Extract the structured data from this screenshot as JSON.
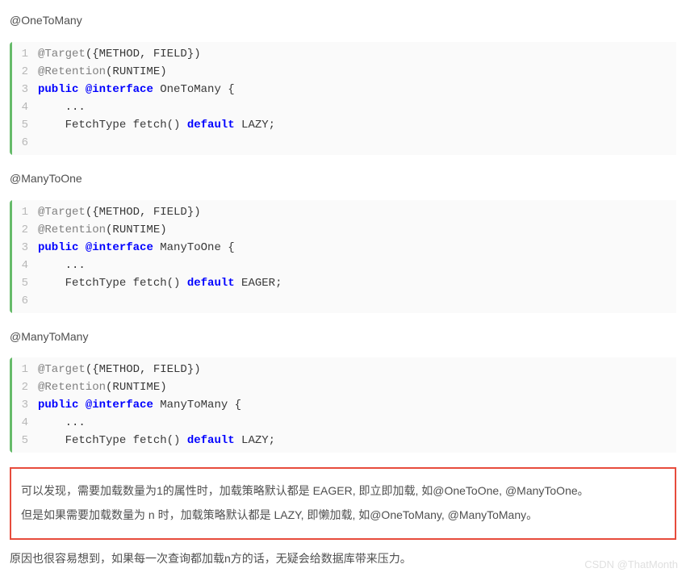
{
  "sections": [
    {
      "heading": "@OneToMany",
      "lines": [
        "1",
        "2",
        "3",
        "4",
        "5",
        "6"
      ]
    },
    {
      "heading": "@ManyToOne",
      "lines": [
        "1",
        "2",
        "3",
        "4",
        "5",
        "6"
      ]
    },
    {
      "heading": "@ManyToMany",
      "lines": [
        "1",
        "2",
        "3",
        "4",
        "5"
      ]
    }
  ],
  "code1": {
    "l1a": "@Target",
    "l1b": "({METHOD, FIELD})",
    "l2a": "@Retention",
    "l2b": "(RUNTIME)",
    "l3": "",
    "l4a": "public",
    "l4b": " ",
    "l4c": "@interface",
    "l4d": " OneToMany {",
    "l5": "    ...",
    "l6a": "    FetchType fetch() ",
    "l6b": "default",
    "l6c": " LAZY;"
  },
  "code2": {
    "l1a": "@Target",
    "l1b": "({METHOD, FIELD})",
    "l2a": "@Retention",
    "l2b": "(RUNTIME)",
    "l3": "",
    "l4a": "public",
    "l4b": " ",
    "l4c": "@interface",
    "l4d": " ManyToOne {",
    "l5": "    ...",
    "l6a": "    FetchType fetch() ",
    "l6b": "default",
    "l6c": " EAGER;"
  },
  "code3": {
    "l1a": "@Target",
    "l1b": "({METHOD, FIELD})",
    "l2a": "@Retention",
    "l2b": "(RUNTIME)",
    "l3a": "public",
    "l3b": " ",
    "l3c": "@interface",
    "l3d": " ManyToMany {",
    "l4": "    ...",
    "l5a": "    FetchType fetch() ",
    "l5b": "default",
    "l5c": " LAZY;"
  },
  "callout": {
    "p1": "可以发现，需要加载数量为1的属性时，加载策略默认都是 EAGER, 即立即加载, 如@OneToOne, @ManyToOne。",
    "p2": "但是如果需要加载数量为 n 时，加载策略默认都是 LAZY, 即懒加载, 如@OneToMany, @ManyToMany。"
  },
  "footer": "原因也很容易想到，如果每一次查询都加载n方的话，无疑会给数据库带来压力。",
  "watermark": "CSDN @ThatMonth"
}
